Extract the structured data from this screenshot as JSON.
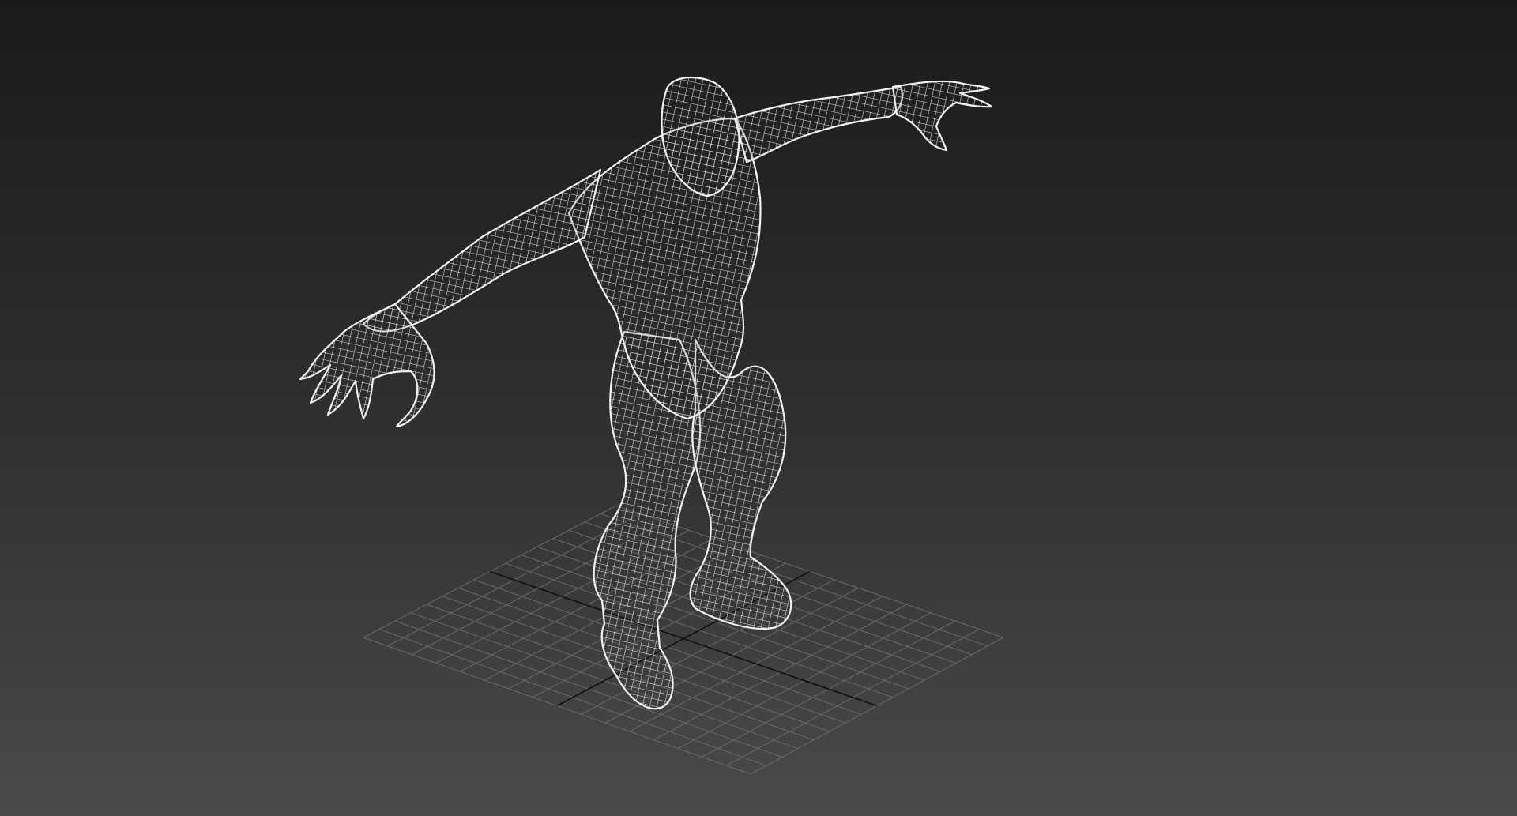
{
  "viewport": {
    "background_top": "#1b1b1b",
    "background_bottom": "#4a4a4a",
    "grid_color": "#6a6a6a",
    "axis_color": "#0e0e0e",
    "wire_color": "#e8e8e8",
    "grid_divisions": 16
  },
  "model": {
    "display_mode": "wireframe",
    "pose": "T-pose creature"
  }
}
